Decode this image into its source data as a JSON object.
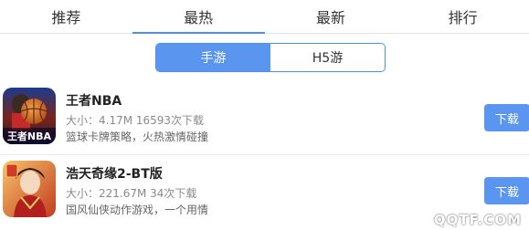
{
  "tabs": [
    {
      "label": "推荐"
    },
    {
      "label": "最热"
    },
    {
      "label": "最新"
    },
    {
      "label": "排行"
    }
  ],
  "segment": [
    {
      "label": "手游"
    },
    {
      "label": "H5游"
    }
  ],
  "games": [
    {
      "title": "王者NBA",
      "meta": "大小：4.17M 16593次下载",
      "desc": "篮球卡牌策略，火热激情碰撞",
      "icon_text": "王者NBA",
      "button": "下载"
    },
    {
      "title": "浩天奇缘2-BT版",
      "meta": "大小：221.67M 34次下载",
      "desc": "国风仙侠动作游戏，一个用情",
      "icon_text": "",
      "button": "下载"
    }
  ],
  "watermark": "QQTF.COM",
  "colors": {
    "accent": "#5a96f0",
    "divider": "#e5e5e5"
  }
}
